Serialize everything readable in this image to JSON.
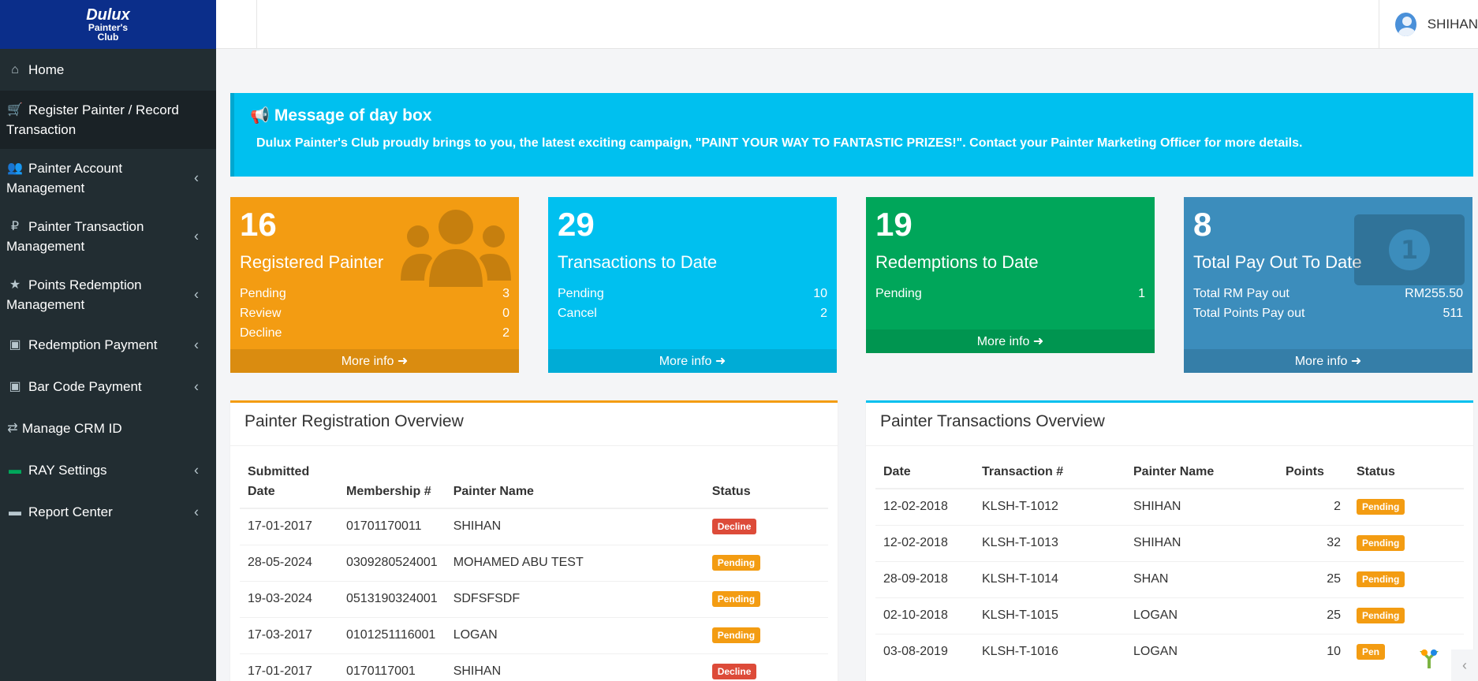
{
  "logo": {
    "brand": "Dulux",
    "sub1": "Painter's",
    "sub2": "Club"
  },
  "sidebar": {
    "items": [
      {
        "label": "Home",
        "icon": "home-icon"
      },
      {
        "label": "Register Painter / Record Transaction",
        "icon": "cart-icon"
      },
      {
        "label": "Painter Account Management",
        "icon": "users-icon"
      },
      {
        "label": "Painter Transaction Management",
        "icon": "ruble-icon"
      },
      {
        "label": "Points Redemption Management",
        "icon": "star-icon"
      },
      {
        "label": "Redemption Payment",
        "icon": "money-icon"
      },
      {
        "label": "Bar Code Payment",
        "icon": "money-icon"
      },
      {
        "label": "Manage CRM ID",
        "icon": "exchange-icon"
      },
      {
        "label": "RAY Settings",
        "icon": "folder-icon"
      },
      {
        "label": "Report Center",
        "icon": "folder-icon"
      }
    ]
  },
  "topbar": {
    "toggle_icon": "",
    "user_name": "SHIHAN"
  },
  "message": {
    "title": "Message of day box",
    "body": "Dulux Painter's Club proudly brings to you, the latest exciting campaign, \"PAINT YOUR WAY TO FANTASTIC PRIZES!\". Contact your Painter Marketing Officer for more details."
  },
  "stats": {
    "registered": {
      "number": "16",
      "title": "Registered Painter",
      "rows": [
        {
          "label": "Pending",
          "value": "3"
        },
        {
          "label": "Review",
          "value": "0"
        },
        {
          "label": "Decline",
          "value": "2"
        }
      ],
      "more": "More info"
    },
    "transactions": {
      "number": "29",
      "title": "Transactions to Date",
      "rows": [
        {
          "label": "Pending",
          "value": "10"
        },
        {
          "label": "Cancel",
          "value": "2"
        }
      ],
      "more": "More info"
    },
    "redemptions": {
      "number": "19",
      "title": "Redemptions to Date",
      "rows": [
        {
          "label": "Pending",
          "value": "1"
        }
      ],
      "more": "More info"
    },
    "payout": {
      "number": "8",
      "title": "Total Pay Out To Date",
      "rows": [
        {
          "label": "Total RM Pay out",
          "value": "RM255.50"
        },
        {
          "label": "Total Points Pay out",
          "value": "511"
        }
      ],
      "more": "More info"
    }
  },
  "registration_panel": {
    "title": "Painter Registration Overview",
    "headers": [
      "Submitted Date",
      "Membership #",
      "Painter Name",
      "Status"
    ],
    "rows": [
      {
        "date": "17-01-2017",
        "membership": "01701170011",
        "name": "SHIHAN",
        "status": "Decline"
      },
      {
        "date": "28-05-2024",
        "membership": "0309280524001",
        "name": "MOHAMED ABU TEST",
        "status": "Pending"
      },
      {
        "date": "19-03-2024",
        "membership": "0513190324001",
        "name": "SDFSFSDF",
        "status": "Pending"
      },
      {
        "date": "17-03-2017",
        "membership": "0101251116001",
        "name": "LOGAN",
        "status": "Pending"
      },
      {
        "date": "17-01-2017",
        "membership": "0170117001",
        "name": "SHIHAN",
        "status": "Decline"
      }
    ]
  },
  "transactions_panel": {
    "title": "Painter Transactions Overview",
    "headers": [
      "Date",
      "Transaction #",
      "Painter Name",
      "Points",
      "Status"
    ],
    "rows": [
      {
        "date": "12-02-2018",
        "txn": "KLSH-T-1012",
        "name": "SHIHAN",
        "points": "2",
        "status": "Pending"
      },
      {
        "date": "12-02-2018",
        "txn": "KLSH-T-1013",
        "name": "SHIHAN",
        "points": "32",
        "status": "Pending"
      },
      {
        "date": "28-09-2018",
        "txn": "KLSH-T-1014",
        "name": "SHAN",
        "points": "25",
        "status": "Pending"
      },
      {
        "date": "02-10-2018",
        "txn": "KLSH-T-1015",
        "name": "LOGAN",
        "points": "25",
        "status": "Pending"
      },
      {
        "date": "03-08-2019",
        "txn": "KLSH-T-1016",
        "name": "LOGAN",
        "points": "10",
        "status": "Pen"
      }
    ]
  },
  "colors": {
    "sidebar": "#222d32",
    "logo_bg": "#0b2e8a",
    "orange": "#f39c12",
    "aqua": "#00c0ef",
    "green": "#00a65a",
    "blue": "#3c8dbc",
    "red": "#dd4b39"
  }
}
